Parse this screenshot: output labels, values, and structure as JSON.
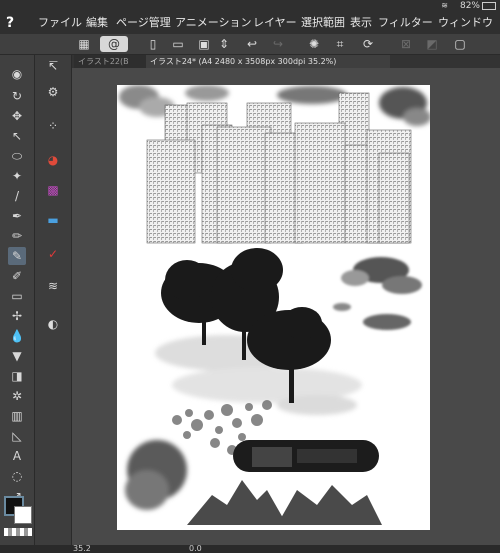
{
  "status": {
    "battery": "82%"
  },
  "menu": [
    {
      "label": "ファイル"
    },
    {
      "label": "編集"
    },
    {
      "label": "ページ管理"
    },
    {
      "label": "アニメーション"
    },
    {
      "label": "レイヤー"
    },
    {
      "label": "選択範囲"
    },
    {
      "label": "表示"
    },
    {
      "label": "フィルター"
    },
    {
      "label": "ウィンドウ"
    }
  ],
  "tabs": [
    {
      "label": "イラスト22(B"
    },
    {
      "label": "イラスト24* (A4 2480 x 3508px 300dpi 35.2%)"
    }
  ],
  "bottom": {
    "zoom": "35.2",
    "angle": "0.0"
  },
  "colors": {
    "accent": "#5a6a7a",
    "foreground": "#111111",
    "background": "#ffffff"
  }
}
